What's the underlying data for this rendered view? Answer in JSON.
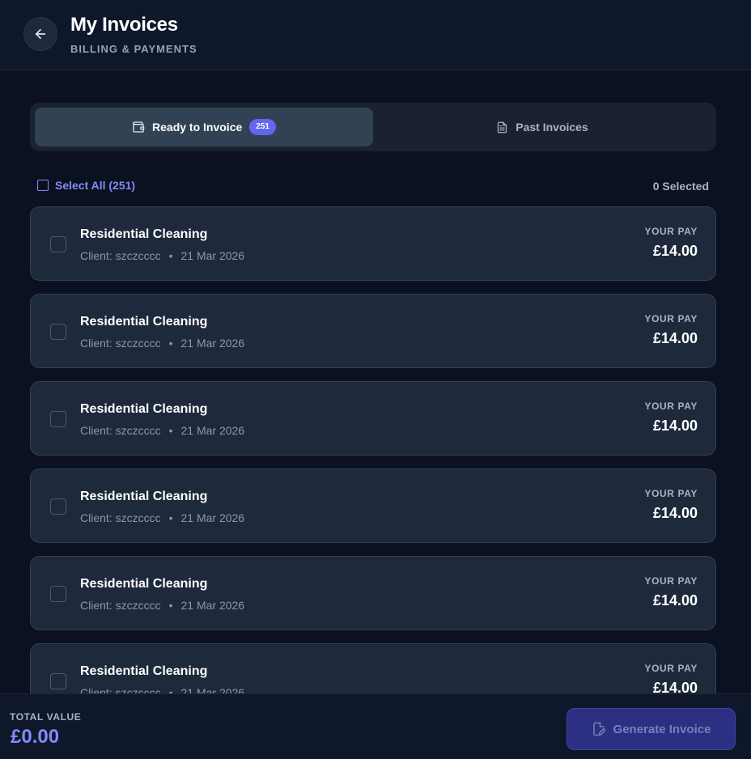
{
  "header": {
    "title": "My Invoices",
    "subtitle": "BILLING & PAYMENTS"
  },
  "tabs": [
    {
      "label": "Ready to Invoice",
      "count": "251",
      "active": true,
      "icon": "wallet-icon"
    },
    {
      "label": "Past Invoices",
      "active": false,
      "icon": "document-icon"
    }
  ],
  "selection": {
    "select_all_label": "Select All (251)",
    "selected_label": "0 Selected"
  },
  "jobs": [
    {
      "title": "Residential Cleaning",
      "client": "Client: szczcccc",
      "separator": "•",
      "date": "21 Mar 2026",
      "pay_label": "YOUR PAY",
      "pay": "£14.00"
    },
    {
      "title": "Residential Cleaning",
      "client": "Client: szczcccc",
      "separator": "•",
      "date": "21 Mar 2026",
      "pay_label": "YOUR PAY",
      "pay": "£14.00"
    },
    {
      "title": "Residential Cleaning",
      "client": "Client: szczcccc",
      "separator": "•",
      "date": "21 Mar 2026",
      "pay_label": "YOUR PAY",
      "pay": "£14.00"
    },
    {
      "title": "Residential Cleaning",
      "client": "Client: szczcccc",
      "separator": "•",
      "date": "21 Mar 2026",
      "pay_label": "YOUR PAY",
      "pay": "£14.00"
    },
    {
      "title": "Residential Cleaning",
      "client": "Client: szczcccc",
      "separator": "•",
      "date": "21 Mar 2026",
      "pay_label": "YOUR PAY",
      "pay": "£14.00"
    },
    {
      "title": "Residential Cleaning",
      "client": "Client: szczcccc",
      "separator": "•",
      "date": "21 Mar 2026",
      "pay_label": "YOUR PAY",
      "pay": "£14.00"
    }
  ],
  "footer": {
    "total_label": "TOTAL VALUE",
    "total_value": "£0.00",
    "generate_label": "Generate Invoice",
    "generate_icon": "edit-icon"
  },
  "colors": {
    "background": "#0b1120",
    "surface": "#1e293b",
    "accent": "#6366f1",
    "accent_text": "#818cf8"
  }
}
